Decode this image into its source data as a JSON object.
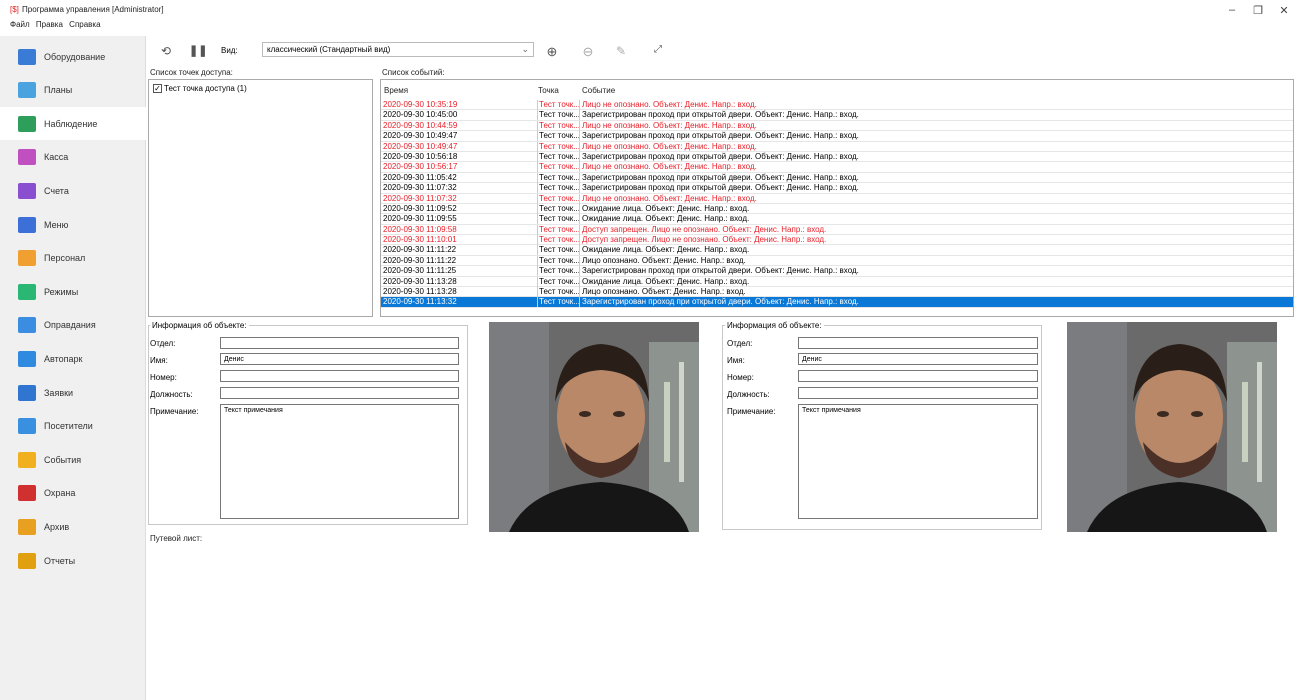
{
  "app": {
    "icon_text": "[$]",
    "title": "Программа управления [Administrator]",
    "menu": [
      "Файл",
      "Правка",
      "Справка"
    ],
    "window_controls": [
      "–",
      "❐",
      "✕"
    ]
  },
  "sidebar": {
    "items": [
      {
        "label": "Оборудование",
        "icon": "equipment-icon",
        "color": "#3a7bd5"
      },
      {
        "label": "Планы",
        "icon": "plans-icon",
        "color": "#4aa3df"
      },
      {
        "label": "Наблюдение",
        "icon": "monitor-icon",
        "color": "#2e9e5b"
      },
      {
        "label": "Касса",
        "icon": "cash-icon",
        "color": "#c050c0"
      },
      {
        "label": "Счета",
        "icon": "accounts-icon",
        "color": "#8a4fd0"
      },
      {
        "label": "Меню",
        "icon": "menu-icon",
        "color": "#3c6fd8"
      },
      {
        "label": "Персонал",
        "icon": "staff-icon",
        "color": "#f0a030"
      },
      {
        "label": "Режимы",
        "icon": "modes-icon",
        "color": "#2ab673"
      },
      {
        "label": "Оправдания",
        "icon": "excuses-icon",
        "color": "#3a8de0"
      },
      {
        "label": "Автопарк",
        "icon": "car-icon",
        "color": "#2f8ae0"
      },
      {
        "label": "Заявки",
        "icon": "requests-icon",
        "color": "#3076d0"
      },
      {
        "label": "Посетители",
        "icon": "visitors-icon",
        "color": "#3a90e0"
      },
      {
        "label": "События",
        "icon": "bell-icon",
        "color": "#f0b020"
      },
      {
        "label": "Охрана",
        "icon": "alarm-icon",
        "color": "#d03030"
      },
      {
        "label": "Архив",
        "icon": "archive-icon",
        "color": "#e8a020"
      },
      {
        "label": "Отчеты",
        "icon": "reports-icon",
        "color": "#e0a010"
      }
    ]
  },
  "toolbar": {
    "view_label": "Вид:",
    "view_value": "классический (Стандартный вид)",
    "icons": [
      "refresh-icon",
      "pause-icon",
      "add-icon",
      "remove-icon",
      "edit-icon",
      "fullscreen-icon"
    ]
  },
  "access_points": {
    "label": "Список точек доступа:",
    "items": [
      {
        "label": "Тест точка доступа (1)",
        "checked": true
      }
    ]
  },
  "events": {
    "label": "Список событий:",
    "columns": [
      "Время",
      "Точка",
      "Событие"
    ],
    "rows": [
      {
        "time": "2020-09-30 10:35:19",
        "point": "Тест точк...",
        "event": "Лицо не опознано. Объект: Денис. Напр.: вход.",
        "status": "red"
      },
      {
        "time": "2020-09-30 10:45:00",
        "point": "Тест точк...",
        "event": "Зарегистрирован проход при открытой двери. Объект: Денис. Напр.: вход.",
        "status": "normal"
      },
      {
        "time": "2020-09-30 10:44:59",
        "point": "Тест точк...",
        "event": "Лицо не опознано. Объект: Денис. Напр.: вход.",
        "status": "red"
      },
      {
        "time": "2020-09-30 10:49:47",
        "point": "Тест точк...",
        "event": "Зарегистрирован проход при открытой двери. Объект: Денис. Напр.: вход.",
        "status": "normal"
      },
      {
        "time": "2020-09-30 10:49:47",
        "point": "Тест точк...",
        "event": "Лицо не опознано. Объект: Денис. Напр.: вход.",
        "status": "red"
      },
      {
        "time": "2020-09-30 10:56:18",
        "point": "Тест точк...",
        "event": "Зарегистрирован проход при открытой двери. Объект: Денис. Напр.: вход.",
        "status": "normal"
      },
      {
        "time": "2020-09-30 10:56:17",
        "point": "Тест точк...",
        "event": "Лицо не опознано. Объект: Денис. Напр.: вход.",
        "status": "red"
      },
      {
        "time": "2020-09-30 11:05:42",
        "point": "Тест точк...",
        "event": "Зарегистрирован проход при открытой двери. Объект: Денис. Напр.: вход.",
        "status": "normal"
      },
      {
        "time": "2020-09-30 11:07:32",
        "point": "Тест точк...",
        "event": "Зарегистрирован проход при открытой двери. Объект: Денис. Напр.: вход.",
        "status": "normal"
      },
      {
        "time": "2020-09-30 11:07:32",
        "point": "Тест точк...",
        "event": "Лицо не опознано. Объект: Денис. Напр.: вход.",
        "status": "red"
      },
      {
        "time": "2020-09-30 11:09:52",
        "point": "Тест точк...",
        "event": "Ожидание лица. Объект: Денис. Напр.: вход.",
        "status": "normal"
      },
      {
        "time": "2020-09-30 11:09:55",
        "point": "Тест точк...",
        "event": "Ожидание лица. Объект: Денис. Напр.: вход.",
        "status": "normal"
      },
      {
        "time": "2020-09-30 11:09:58",
        "point": "Тест точк...",
        "event": "Доступ запрещен. Лицо не опознано. Объект: Денис. Напр.: вход.",
        "status": "red"
      },
      {
        "time": "2020-09-30 11:10:01",
        "point": "Тест точк...",
        "event": "Доступ запрещен. Лицо не опознано. Объект: Денис. Напр.: вход.",
        "status": "red"
      },
      {
        "time": "2020-09-30 11:11:22",
        "point": "Тест точк...",
        "event": "Ожидание лица. Объект: Денис. Напр.: вход.",
        "status": "normal"
      },
      {
        "time": "2020-09-30 11:11:22",
        "point": "Тест точк...",
        "event": "Лицо опознано. Объект: Денис. Напр.: вход.",
        "status": "normal"
      },
      {
        "time": "2020-09-30 11:11:25",
        "point": "Тест точк...",
        "event": "Зарегистрирован проход при открытой двери. Объект: Денис. Напр.: вход.",
        "status": "normal"
      },
      {
        "time": "2020-09-30 11:13:28",
        "point": "Тест точк...",
        "event": "Ожидание лица. Объект: Денис. Напр.: вход.",
        "status": "normal"
      },
      {
        "time": "2020-09-30 11:13:28",
        "point": "Тест точк...",
        "event": "Лицо опознано. Объект: Денис. Напр.: вход.",
        "status": "normal"
      },
      {
        "time": "2020-09-30 11:13:32",
        "point": "Тест точк...",
        "event": "Зарегистрирован проход при открытой двери. Объект: Денис. Напр.: вход.",
        "status": "selected"
      }
    ]
  },
  "info_left": {
    "title": "Информация об объекте:",
    "labels": {
      "dept": "Отдел:",
      "name": "Имя:",
      "number": "Номер:",
      "position": "Должность:",
      "note": "Примечание:"
    },
    "values": {
      "dept": "",
      "name": "Денис",
      "number": "",
      "position": "",
      "note": "Текст примечания"
    }
  },
  "info_right": {
    "title": "Информация об объекте:",
    "labels": {
      "dept": "Отдел:",
      "name": "Имя:",
      "number": "Номер:",
      "position": "Должность:",
      "note": "Примечание:"
    },
    "values": {
      "dept": "",
      "name": "Денис",
      "number": "",
      "position": "",
      "note": "Текст примечания"
    }
  },
  "route_label": "Путевой лист:",
  "colors": {
    "selected_row": "#0a78d7",
    "alert_text": "#e8202a",
    "sidebar_bg": "#f0f0f0"
  }
}
